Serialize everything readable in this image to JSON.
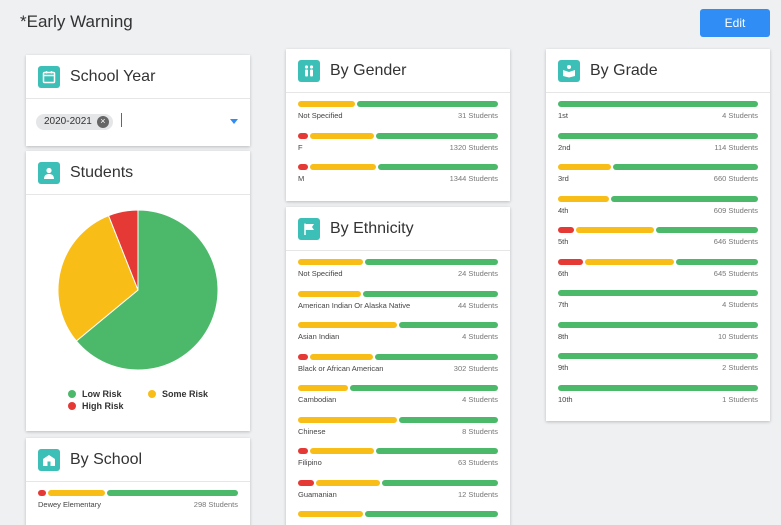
{
  "header": {
    "title": "*Early Warning",
    "edit_label": "Edit"
  },
  "colors": {
    "low": "#4cb96a",
    "some": "#f9bd18",
    "high": "#e53935",
    "accent": "#2f8df5",
    "icon_bg": "#3bbfb6"
  },
  "school_year": {
    "title": "School Year",
    "selected": "2020-2021",
    "icon": "calendar-icon"
  },
  "students": {
    "title": "Students",
    "icon": "student-icon",
    "legend": {
      "low": "Low Risk",
      "some": "Some Risk",
      "high": "High Risk"
    }
  },
  "chart_data": {
    "type": "pie",
    "categories": [
      "Low Risk",
      "Some Risk",
      "High Risk"
    ],
    "values": [
      64,
      30,
      6
    ],
    "colors": [
      "#4cb96a",
      "#f9bd18",
      "#e53935"
    ],
    "legend_position": "bottom"
  },
  "by_school": {
    "title": "By School",
    "icon": "school-icon",
    "rows": [
      {
        "label": "Dewey Elementary",
        "count": "298 Students",
        "red": 4,
        "yellow": 29,
        "green": 67
      }
    ]
  },
  "by_gender": {
    "title": "By Gender",
    "icon": "gender-icon",
    "rows": [
      {
        "label": "Not Specified",
        "count": "31 Students",
        "red": 0,
        "yellow": 29,
        "green": 71
      },
      {
        "label": "F",
        "count": "1320 Students",
        "red": 5,
        "yellow": 33,
        "green": 62
      },
      {
        "label": "M",
        "count": "1344 Students",
        "red": 5,
        "yellow": 34,
        "green": 61
      }
    ]
  },
  "by_ethnicity": {
    "title": "By Ethnicity",
    "icon": "flag-icon",
    "rows": [
      {
        "label": "Not Specified",
        "count": "24 Students",
        "red": 0,
        "yellow": 33,
        "green": 67
      },
      {
        "label": "American Indian Or Alaska Native",
        "count": "44 Students",
        "red": 0,
        "yellow": 32,
        "green": 68
      },
      {
        "label": "Asian Indian",
        "count": "4 Students",
        "red": 0,
        "yellow": 50,
        "green": 50
      },
      {
        "label": "Black or African American",
        "count": "302 Students",
        "red": 5,
        "yellow": 32,
        "green": 63
      },
      {
        "label": "Cambodian",
        "count": "4 Students",
        "red": 0,
        "yellow": 25,
        "green": 75
      },
      {
        "label": "Chinese",
        "count": "8 Students",
        "red": 0,
        "yellow": 50,
        "green": 50
      },
      {
        "label": "Filipino",
        "count": "63 Students",
        "red": 5,
        "yellow": 33,
        "green": 62
      },
      {
        "label": "Guamanian",
        "count": "12 Students",
        "red": 8,
        "yellow": 33,
        "green": 59
      },
      {
        "label": "",
        "count": "",
        "red": 0,
        "yellow": 33,
        "green": 67
      }
    ]
  },
  "by_grade": {
    "title": "By Grade",
    "icon": "grade-icon",
    "rows": [
      {
        "label": "1st",
        "count": "4 Students",
        "red": 0,
        "yellow": 0,
        "green": 100
      },
      {
        "label": "2nd",
        "count": "114 Students",
        "red": 0,
        "yellow": 0,
        "green": 100
      },
      {
        "label": "3rd",
        "count": "660 Students",
        "red": 0,
        "yellow": 27,
        "green": 73
      },
      {
        "label": "4th",
        "count": "609 Students",
        "red": 0,
        "yellow": 26,
        "green": 74
      },
      {
        "label": "5th",
        "count": "646 Students",
        "red": 8,
        "yellow": 40,
        "green": 52
      },
      {
        "label": "6th",
        "count": "645 Students",
        "red": 13,
        "yellow": 45,
        "green": 42
      },
      {
        "label": "7th",
        "count": "4 Students",
        "red": 0,
        "yellow": 0,
        "green": 100
      },
      {
        "label": "8th",
        "count": "10 Students",
        "red": 0,
        "yellow": 0,
        "green": 100
      },
      {
        "label": "9th",
        "count": "2 Students",
        "red": 0,
        "yellow": 0,
        "green": 100
      },
      {
        "label": "10th",
        "count": "1 Students",
        "red": 0,
        "yellow": 0,
        "green": 100
      }
    ]
  }
}
